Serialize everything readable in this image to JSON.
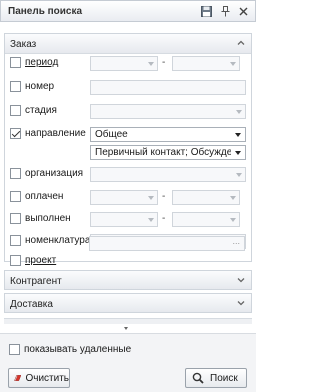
{
  "window": {
    "title": "Панель поиска"
  },
  "groups": {
    "order": {
      "title": "Заказ"
    },
    "counterparty": {
      "title": "Контрагент"
    },
    "delivery": {
      "title": "Доставка"
    }
  },
  "filters": {
    "period": {
      "label": "период",
      "checked": false,
      "separator": "-"
    },
    "number": {
      "label": "номер",
      "checked": false
    },
    "stage": {
      "label": "стадия",
      "checked": false
    },
    "direction": {
      "label": "направление",
      "checked": true,
      "value": "Общее",
      "sub_value": "Первичный контакт; Обсуждени..."
    },
    "organization": {
      "label": "организация",
      "checked": false
    },
    "paid": {
      "label": "оплачен",
      "checked": false,
      "separator": "-"
    },
    "completed": {
      "label": "выполнен",
      "checked": false,
      "separator": "-"
    },
    "nomenclature": {
      "label": "номенклатура",
      "checked": false
    },
    "project": {
      "label": "проект",
      "checked": false,
      "ellipsis": "..."
    }
  },
  "options": {
    "show_deleted": {
      "label": "показывать удаленные",
      "checked": false
    }
  },
  "buttons": {
    "clear": "Очистить",
    "search": "Поиск"
  },
  "icons": [
    "save-icon",
    "pin-icon",
    "close-icon",
    "chevron-up-icon",
    "chevron-down-icon",
    "eraser-icon",
    "search-icon"
  ],
  "colors": {
    "header_bg": "#e9ecf1",
    "border": "#cfd5dc",
    "eraser_red": "#d9342b"
  }
}
